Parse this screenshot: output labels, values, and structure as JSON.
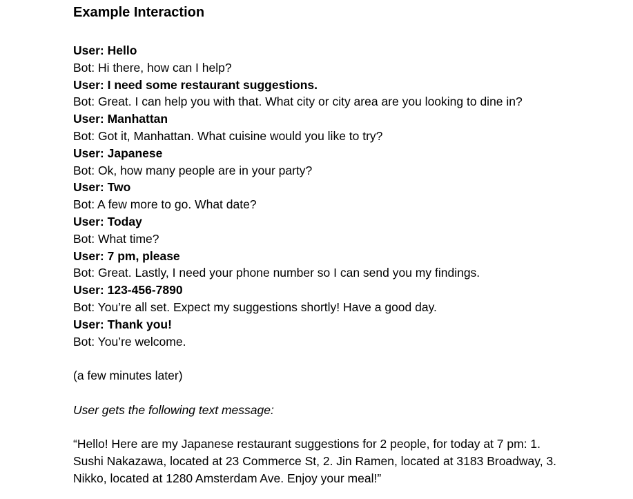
{
  "title": "Example Interaction",
  "dialogue": [
    {
      "speaker": "user",
      "text": "User: Hello"
    },
    {
      "speaker": "bot",
      "text": "Bot: Hi there, how can I help?"
    },
    {
      "speaker": "user",
      "text": "User: I need some restaurant suggestions."
    },
    {
      "speaker": "bot",
      "text": "Bot: Great. I can help you with that. What city or city area are you looking to dine in?"
    },
    {
      "speaker": "user",
      "text": "User: Manhattan"
    },
    {
      "speaker": "bot",
      "text": "Bot: Got it, Manhattan. What cuisine would you like to try?"
    },
    {
      "speaker": "user",
      "text": "User: Japanese"
    },
    {
      "speaker": "bot",
      "text": "Bot: Ok, how many people are in your party?"
    },
    {
      "speaker": "user",
      "text": "User: Two"
    },
    {
      "speaker": "bot",
      "text": "Bot: A few more to go. What date?"
    },
    {
      "speaker": "user",
      "text": "User: Today"
    },
    {
      "speaker": "bot",
      "text": "Bot: What time?"
    },
    {
      "speaker": "user",
      "text": "User: 7 pm, please"
    },
    {
      "speaker": "bot",
      "text": "Bot: Great. Lastly, I need your phone number so I can send you my findings."
    },
    {
      "speaker": "user",
      "text": "User: 123-456-7890"
    },
    {
      "speaker": "bot",
      "text": "Bot: You’re all set. Expect my suggestions shortly! Have a good day."
    },
    {
      "speaker": "user",
      "text": "User: Thank you!"
    },
    {
      "speaker": "bot",
      "text": "Bot: You’re welcome."
    }
  ],
  "later_note": "(a few minutes later)",
  "text_message_intro": "User gets the following text message:",
  "text_message": "“Hello! Here are my Japanese restaurant suggestions for 2 people, for today at 7 pm: 1. Sushi Nakazawa, located at 23 Commerce St, 2. Jin Ramen, located at 3183 Broadway, 3. Nikko, located at 1280 Amsterdam Ave. Enjoy your meal!”"
}
